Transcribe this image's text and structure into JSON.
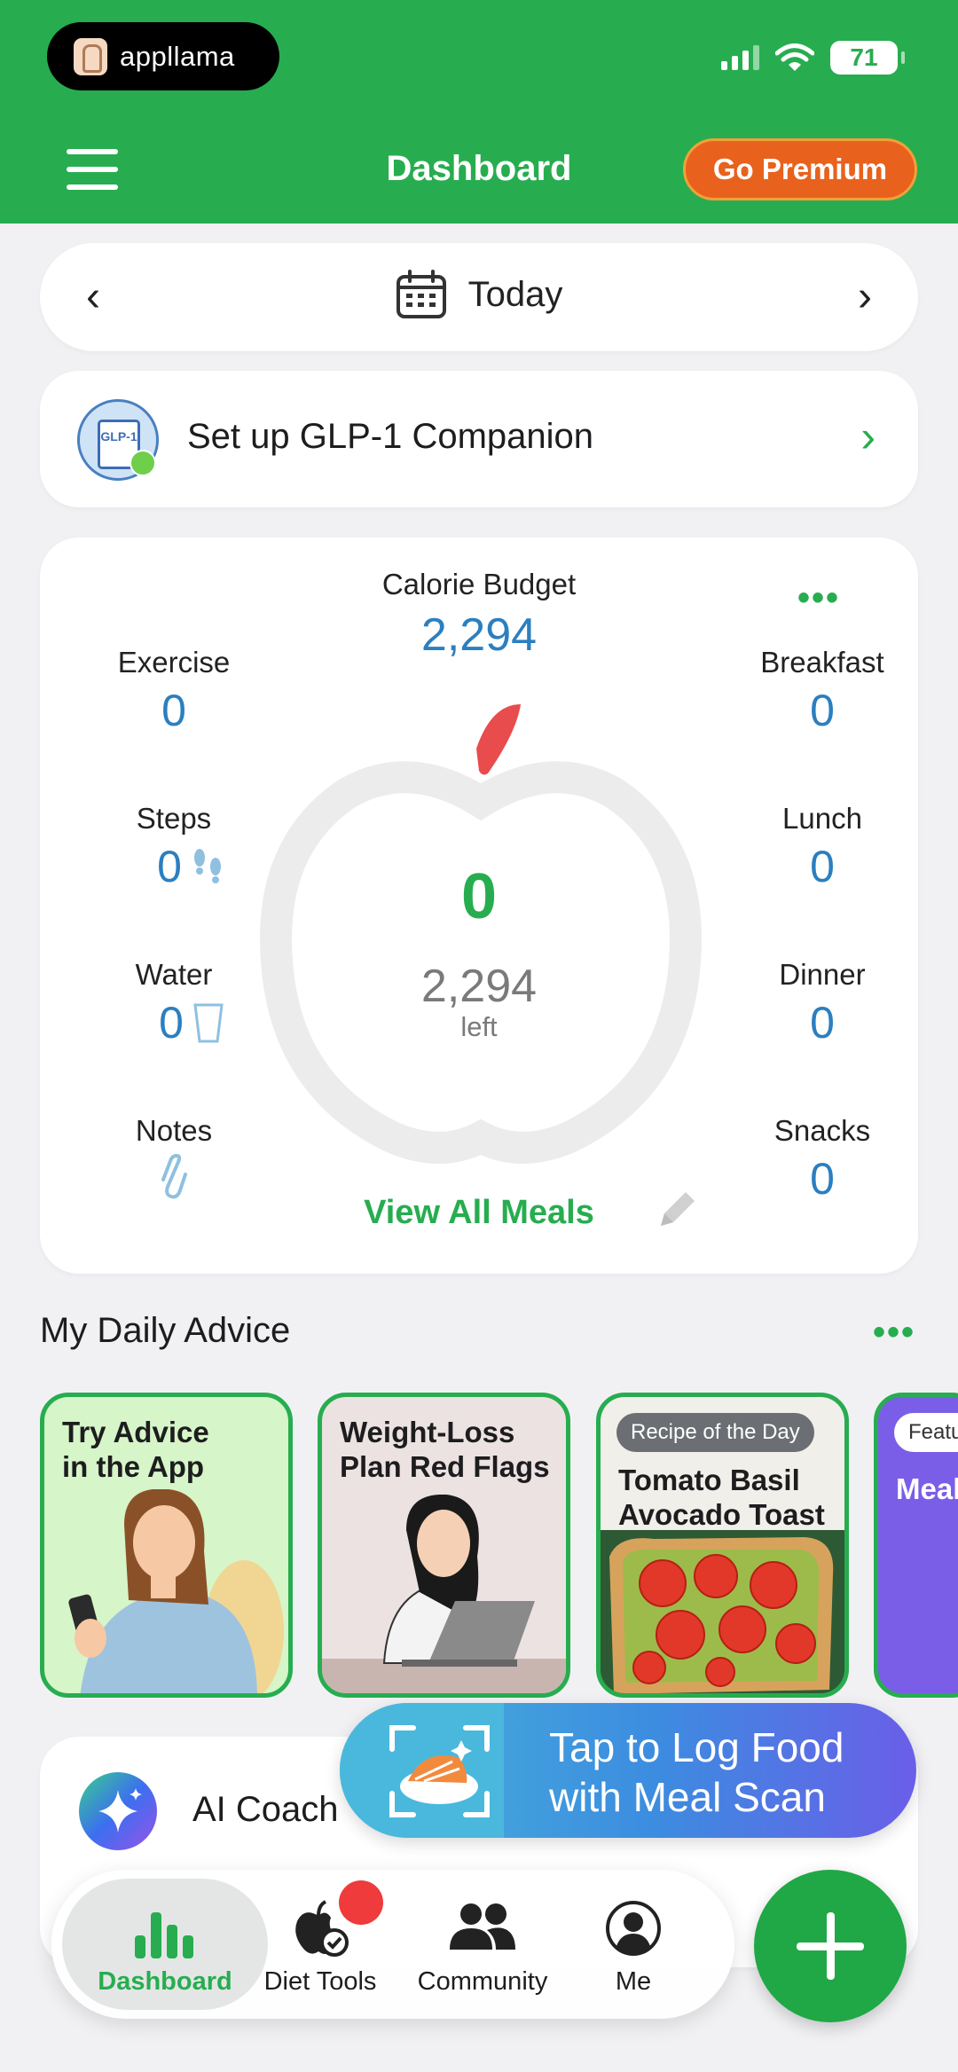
{
  "status_bar": {
    "app_name": "appllama",
    "battery": "71"
  },
  "header": {
    "title": "Dashboard",
    "premium_label": "Go Premium"
  },
  "date_bar": {
    "label": "Today"
  },
  "glp": {
    "label": "Set up GLP-1 Companion",
    "icon_text": "GLP-1"
  },
  "budget": {
    "title": "Calorie Budget",
    "value": "2,294",
    "consumed": "0",
    "left_value": "2,294",
    "left_label": "left",
    "view_all": "View All Meals",
    "left_metrics": [
      {
        "label": "Exercise",
        "value": "0"
      },
      {
        "label": "Steps",
        "value": "0"
      },
      {
        "label": "Water",
        "value": "0"
      },
      {
        "label": "Notes",
        "value": ""
      }
    ],
    "right_metrics": [
      {
        "label": "Breakfast",
        "value": "0"
      },
      {
        "label": "Lunch",
        "value": "0"
      },
      {
        "label": "Dinner",
        "value": "0"
      },
      {
        "label": "Snacks",
        "value": "0"
      }
    ]
  },
  "advice": {
    "title": "My Daily Advice",
    "cards": [
      {
        "title": "Try Advice in the App"
      },
      {
        "title": "Weight-Loss Plan Red Flags"
      },
      {
        "tag": "Recipe of the Day",
        "title": "Tomato Basil Avocado Toast"
      },
      {
        "tag": "Featu",
        "title": "Meal"
      }
    ]
  },
  "ai_coach": {
    "label": "AI Coach"
  },
  "scan_banner": {
    "line1": "Tap to Log Food",
    "line2": "with Meal Scan"
  },
  "bottom_nav": [
    {
      "label": "Dashboard"
    },
    {
      "label": "Diet Tools"
    },
    {
      "label": "Community"
    },
    {
      "label": "Me"
    }
  ],
  "colors": {
    "brand_green": "#27ad4f",
    "accent_orange": "#e8621d",
    "value_blue": "#2b7fc0"
  }
}
